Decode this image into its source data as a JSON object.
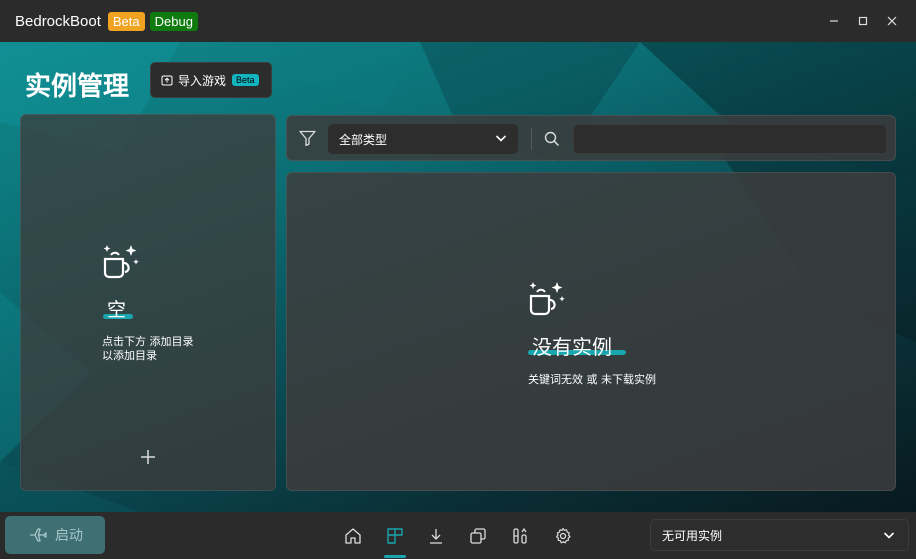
{
  "titlebar": {
    "app_name": "BedrockBoot",
    "badge_beta": "Beta",
    "badge_debug": "Debug",
    "minimize_icon": "minimize-icon",
    "maximize_icon": "maximize-icon",
    "close_icon": "close-icon"
  },
  "header": {
    "page_title": "实例管理",
    "import_button": {
      "label": "导入游戏",
      "badge": "Beta",
      "icon": "import-icon"
    }
  },
  "left_panel": {
    "empty_title": "空",
    "empty_desc_line1": "点击下方 添加目录",
    "empty_desc_line2": "以添加目录",
    "add_icon": "plus-icon",
    "illustration_icon": "empty-box-sparkle-icon"
  },
  "filter": {
    "filter_icon": "filter-icon",
    "type_select_value": "全部类型",
    "search_icon": "search-icon",
    "search_value": ""
  },
  "content": {
    "empty_title": "没有实例",
    "empty_desc": "关键词无效 或 未下载实例",
    "illustration_icon": "empty-box-sparkle-icon"
  },
  "bottombar": {
    "launch_label": "启动",
    "launch_icon": "airplane-icon",
    "nav_icons": [
      "home-icon",
      "instances-icon",
      "download-icon",
      "versions-icon",
      "tools-icon",
      "settings-icon"
    ],
    "active_nav": "instances-icon",
    "instance_select_value": "无可用实例"
  },
  "colors": {
    "accent": "#1aa6ae",
    "beta_badge": "#f0a321",
    "debug_badge": "#0f7b0f"
  }
}
